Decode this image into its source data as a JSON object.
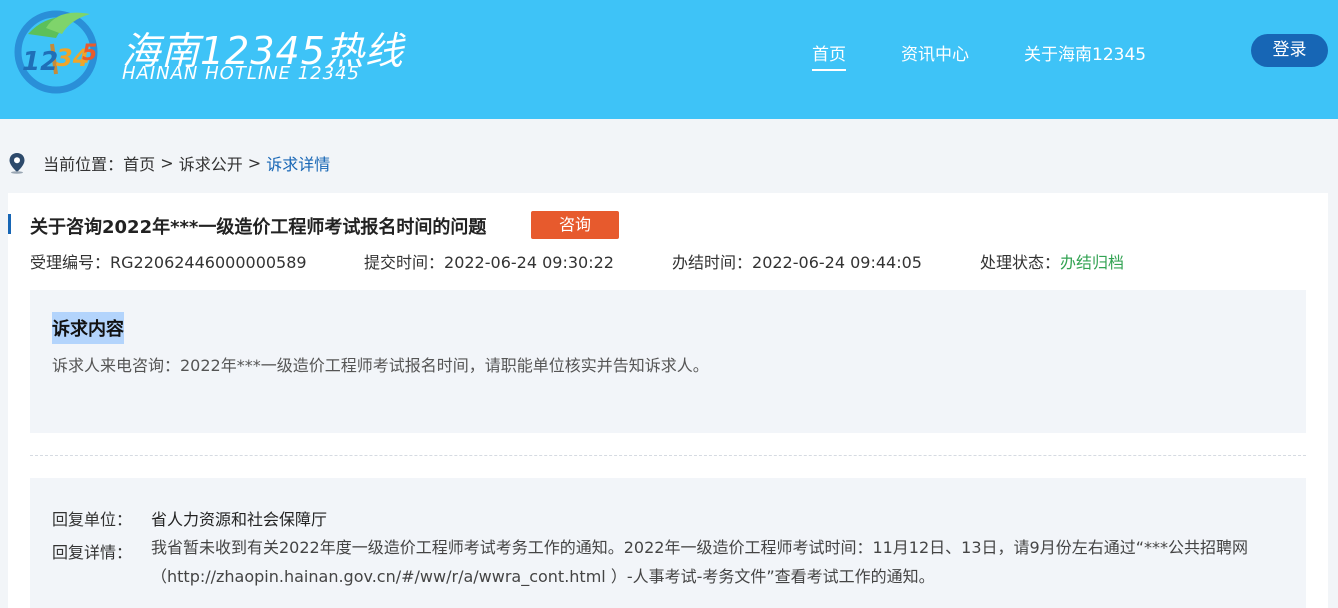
{
  "header": {
    "logo_cn": "海南12345热线",
    "logo_en": "HAINAN HOTLINE 12345",
    "logo_icon": "hotline-12345-palm-logo",
    "bg_color": "#3ec3f7",
    "nav": [
      {
        "label": "首页",
        "active": true
      },
      {
        "label": "资讯中心",
        "active": false
      },
      {
        "label": "关于海南12345",
        "active": false
      }
    ],
    "login_label": "登录",
    "login_color": "#1766b5"
  },
  "breadcrumb": {
    "icon": "location-pin-icon",
    "prefix": "当前位置：",
    "home": "首页",
    "sep1": " > ",
    "section": "诉求公开",
    "sep2": " > ",
    "current": "诉求详情"
  },
  "detail": {
    "title": "关于咨询2022年***一级造价工程师考试报名时间的问题",
    "tag": "咨询",
    "tag_color": "#e75a2d",
    "meta": {
      "id_label": "受理编号：",
      "id_value": "RG22062446000000589",
      "submit_label": "提交时间：",
      "submit_value": "2022-06-24 09:30:22",
      "done_label": "办结时间：",
      "done_value": "2022-06-24 09:44:05",
      "status_label": "处理状态：",
      "status_value": "办结归档",
      "status_color": "#33a353"
    },
    "content_heading": "诉求内容",
    "content_text": "诉求人来电咨询：2022年***一级造价工程师考试报名时间，请职能单位核实并告知诉求人。",
    "reply": {
      "unit_label": "回复单位：",
      "unit_value": "省人力资源和社会保障厅",
      "detail_label": "回复详情：",
      "detail_value": "我省暂未收到有关2022年度一级造价工程师考试考务工作的通知。2022年一级造价工程师考试时间：11月12日、13日，请9月份左右通过“***公共招聘网（http://zhaopin.hainan.gov.cn/#/ww/r/a/wwra_cont.html ）-人事考试-考务文件”查看考试工作的通知。"
    }
  }
}
